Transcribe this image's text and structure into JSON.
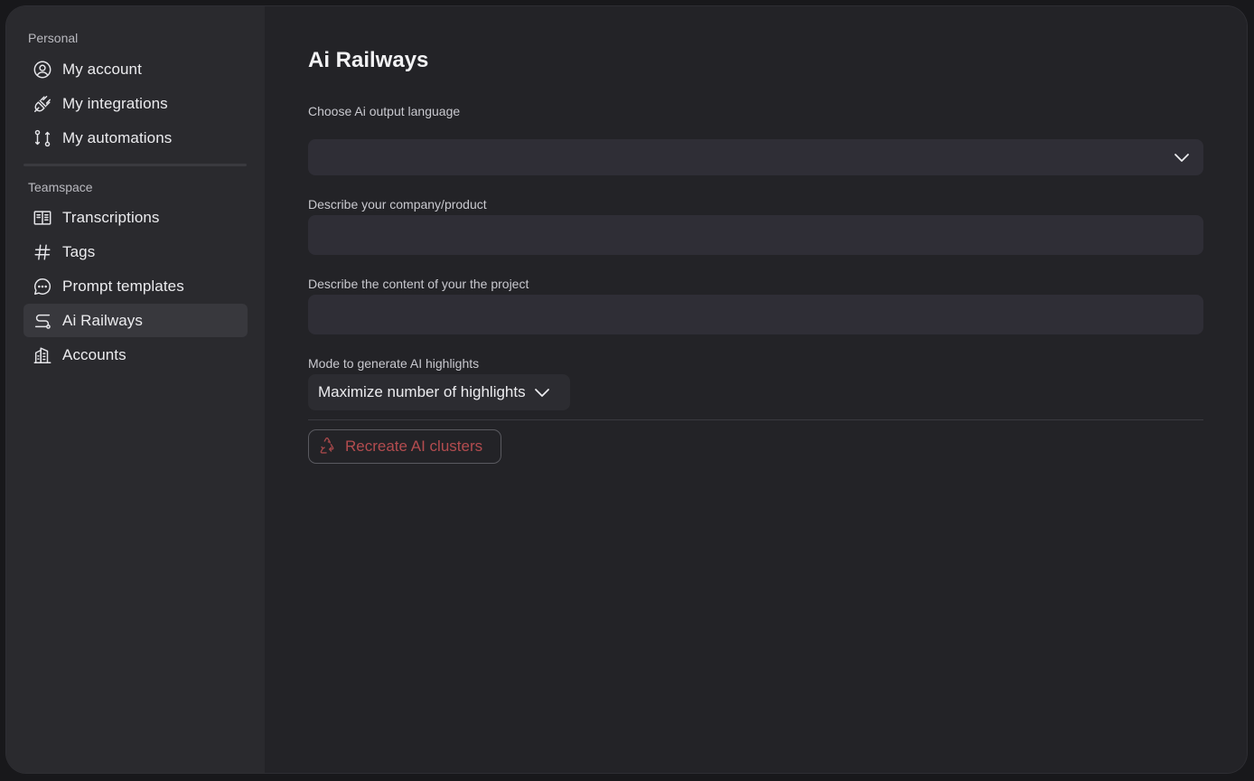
{
  "sidebar": {
    "sections": [
      {
        "label": "Personal",
        "items": [
          {
            "label": "My account",
            "icon": "user-circle-icon"
          },
          {
            "label": "My integrations",
            "icon": "plug-icon"
          },
          {
            "label": "My automations",
            "icon": "git-branch-icon"
          }
        ]
      },
      {
        "label": "Teamspace",
        "items": [
          {
            "label": "Transcriptions",
            "icon": "book-open-icon"
          },
          {
            "label": "Tags",
            "icon": "hashtag-icon"
          },
          {
            "label": "Prompt templates",
            "icon": "chat-bubble-icon"
          },
          {
            "label": "Ai Railways",
            "icon": "route-icon",
            "active": true
          },
          {
            "label": "Accounts",
            "icon": "building-icon"
          }
        ]
      }
    ]
  },
  "main": {
    "title": "Ai Railways",
    "language": {
      "label": "Choose Ai output language",
      "value": ""
    },
    "company": {
      "label": "Describe your company/product",
      "value": "",
      "placeholder": ""
    },
    "project": {
      "label": "Describe the content of your the project",
      "value": "",
      "placeholder": ""
    },
    "mode": {
      "label": "Mode to generate AI highlights",
      "value": "Maximize number of highlights"
    },
    "recreate_button": {
      "label": "Recreate AI clusters",
      "icon": "recycle-icon",
      "color": "#b34c4f"
    }
  },
  "colors": {
    "sidebar_bg": "#2a2a2e",
    "main_bg": "#232327",
    "input_bg": "#2f2e36",
    "active_item_bg": "#38383d"
  }
}
